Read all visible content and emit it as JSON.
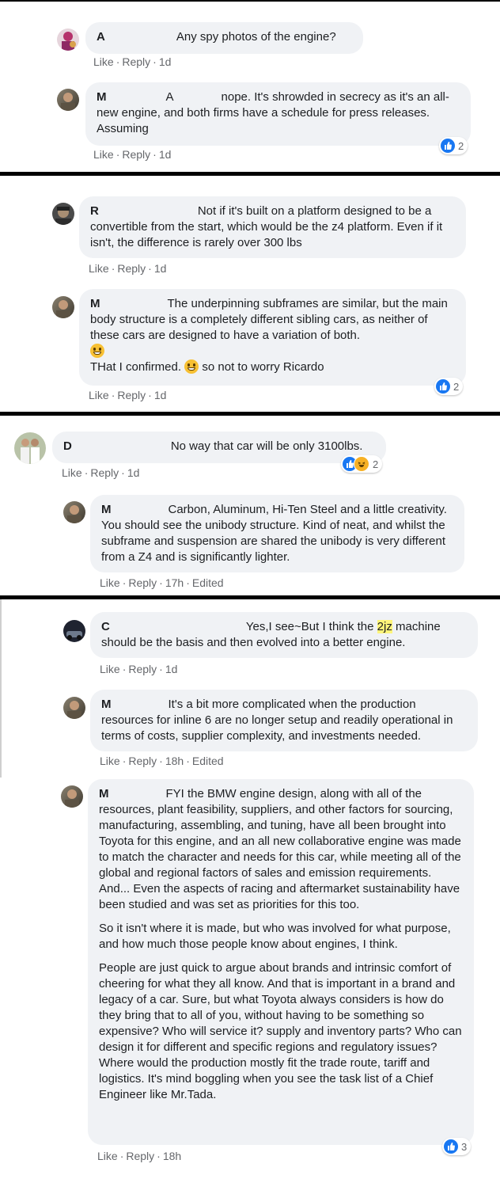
{
  "actions": {
    "like": "Like",
    "reply": "Reply",
    "sep": "·",
    "edited": "Edited"
  },
  "comments": [
    {
      "initial": "A",
      "text": "Any spy photos of the engine?",
      "time": "1d"
    },
    {
      "initial": "M",
      "mention": "A",
      "text": "nope. It's shrowded in secrecy as it's an all-new engine, and both firms have a schedule for press releases. Assuming",
      "time": "1d",
      "reactions": "2"
    },
    {
      "initial": "R",
      "text": "Not if it's built on a platform designed to be a convertible from the start, which would be the z4 platform. Even if it isn't, the difference is rarely over 300 lbs",
      "time": "1d"
    },
    {
      "initial": "M",
      "text": "The underpinning subframes are similar, but the main body structure is a completely different sibling cars, as neither of these cars are designed to have a variation of both.",
      "text2a": "THat I confirmed.",
      "text2b": "so not to worry Ricardo",
      "time": "1d",
      "reactions": "2"
    },
    {
      "initial": "D",
      "text": "No way that car will be only 3100lbs.",
      "time": "1d",
      "reactions": "2"
    },
    {
      "initial": "M",
      "text": "Carbon, Aluminum, Hi-Ten Steel and a little creativity. You should see the unibody structure. Kind of neat, and whilst the subframe and suspension are shared the unibody is very different from a Z4 and is significantly lighter.",
      "time": "17h"
    },
    {
      "initial": "C",
      "text_a": "Yes,I see~But I think the",
      "text_hl": "2jz",
      "text_b": "machine should be the basis and then evolved into a better engine.",
      "time": "1d"
    },
    {
      "initial": "M",
      "text": "It's a bit more complicated when the production resources for inline 6 are no longer setup and readily operational in terms of costs, supplier complexity, and investments needed.",
      "time": "18h"
    },
    {
      "initial": "M",
      "p1": "FYI the BMW engine design, along with all of the resources, plant feasibility, suppliers, and other factors for sourcing, manufacturing, assembling, and tuning, have all been brought into Toyota for this engine, and an all new collaborative engine was made to match the character and needs for this car, while meeting all of the global and regional factors of sales and emission requirements. And... Even the aspects of racing and aftermarket sustainability have been studied and was set as priorities for this too.",
      "p2": "So it isn't where it is made, but who was involved for what purpose, and how much those people know about engines, I think.",
      "p3": "People are just quick to argue about brands and intrinsic comfort of cheering for what they all know. And that is important in a brand and legacy of a car. Sure, but what Toyota always considers is how do they bring that to all of you, without having to be something so expensive? Who will service it? supply and inventory parts? Who can design it for different and specific regions and regulatory issues? Where would the production mostly fit the trade route, tariff and logistics. It's mind boggling when you see the task list of a Chief Engineer like Mr.Tada.",
      "time": "18h",
      "reactions": "3"
    }
  ]
}
